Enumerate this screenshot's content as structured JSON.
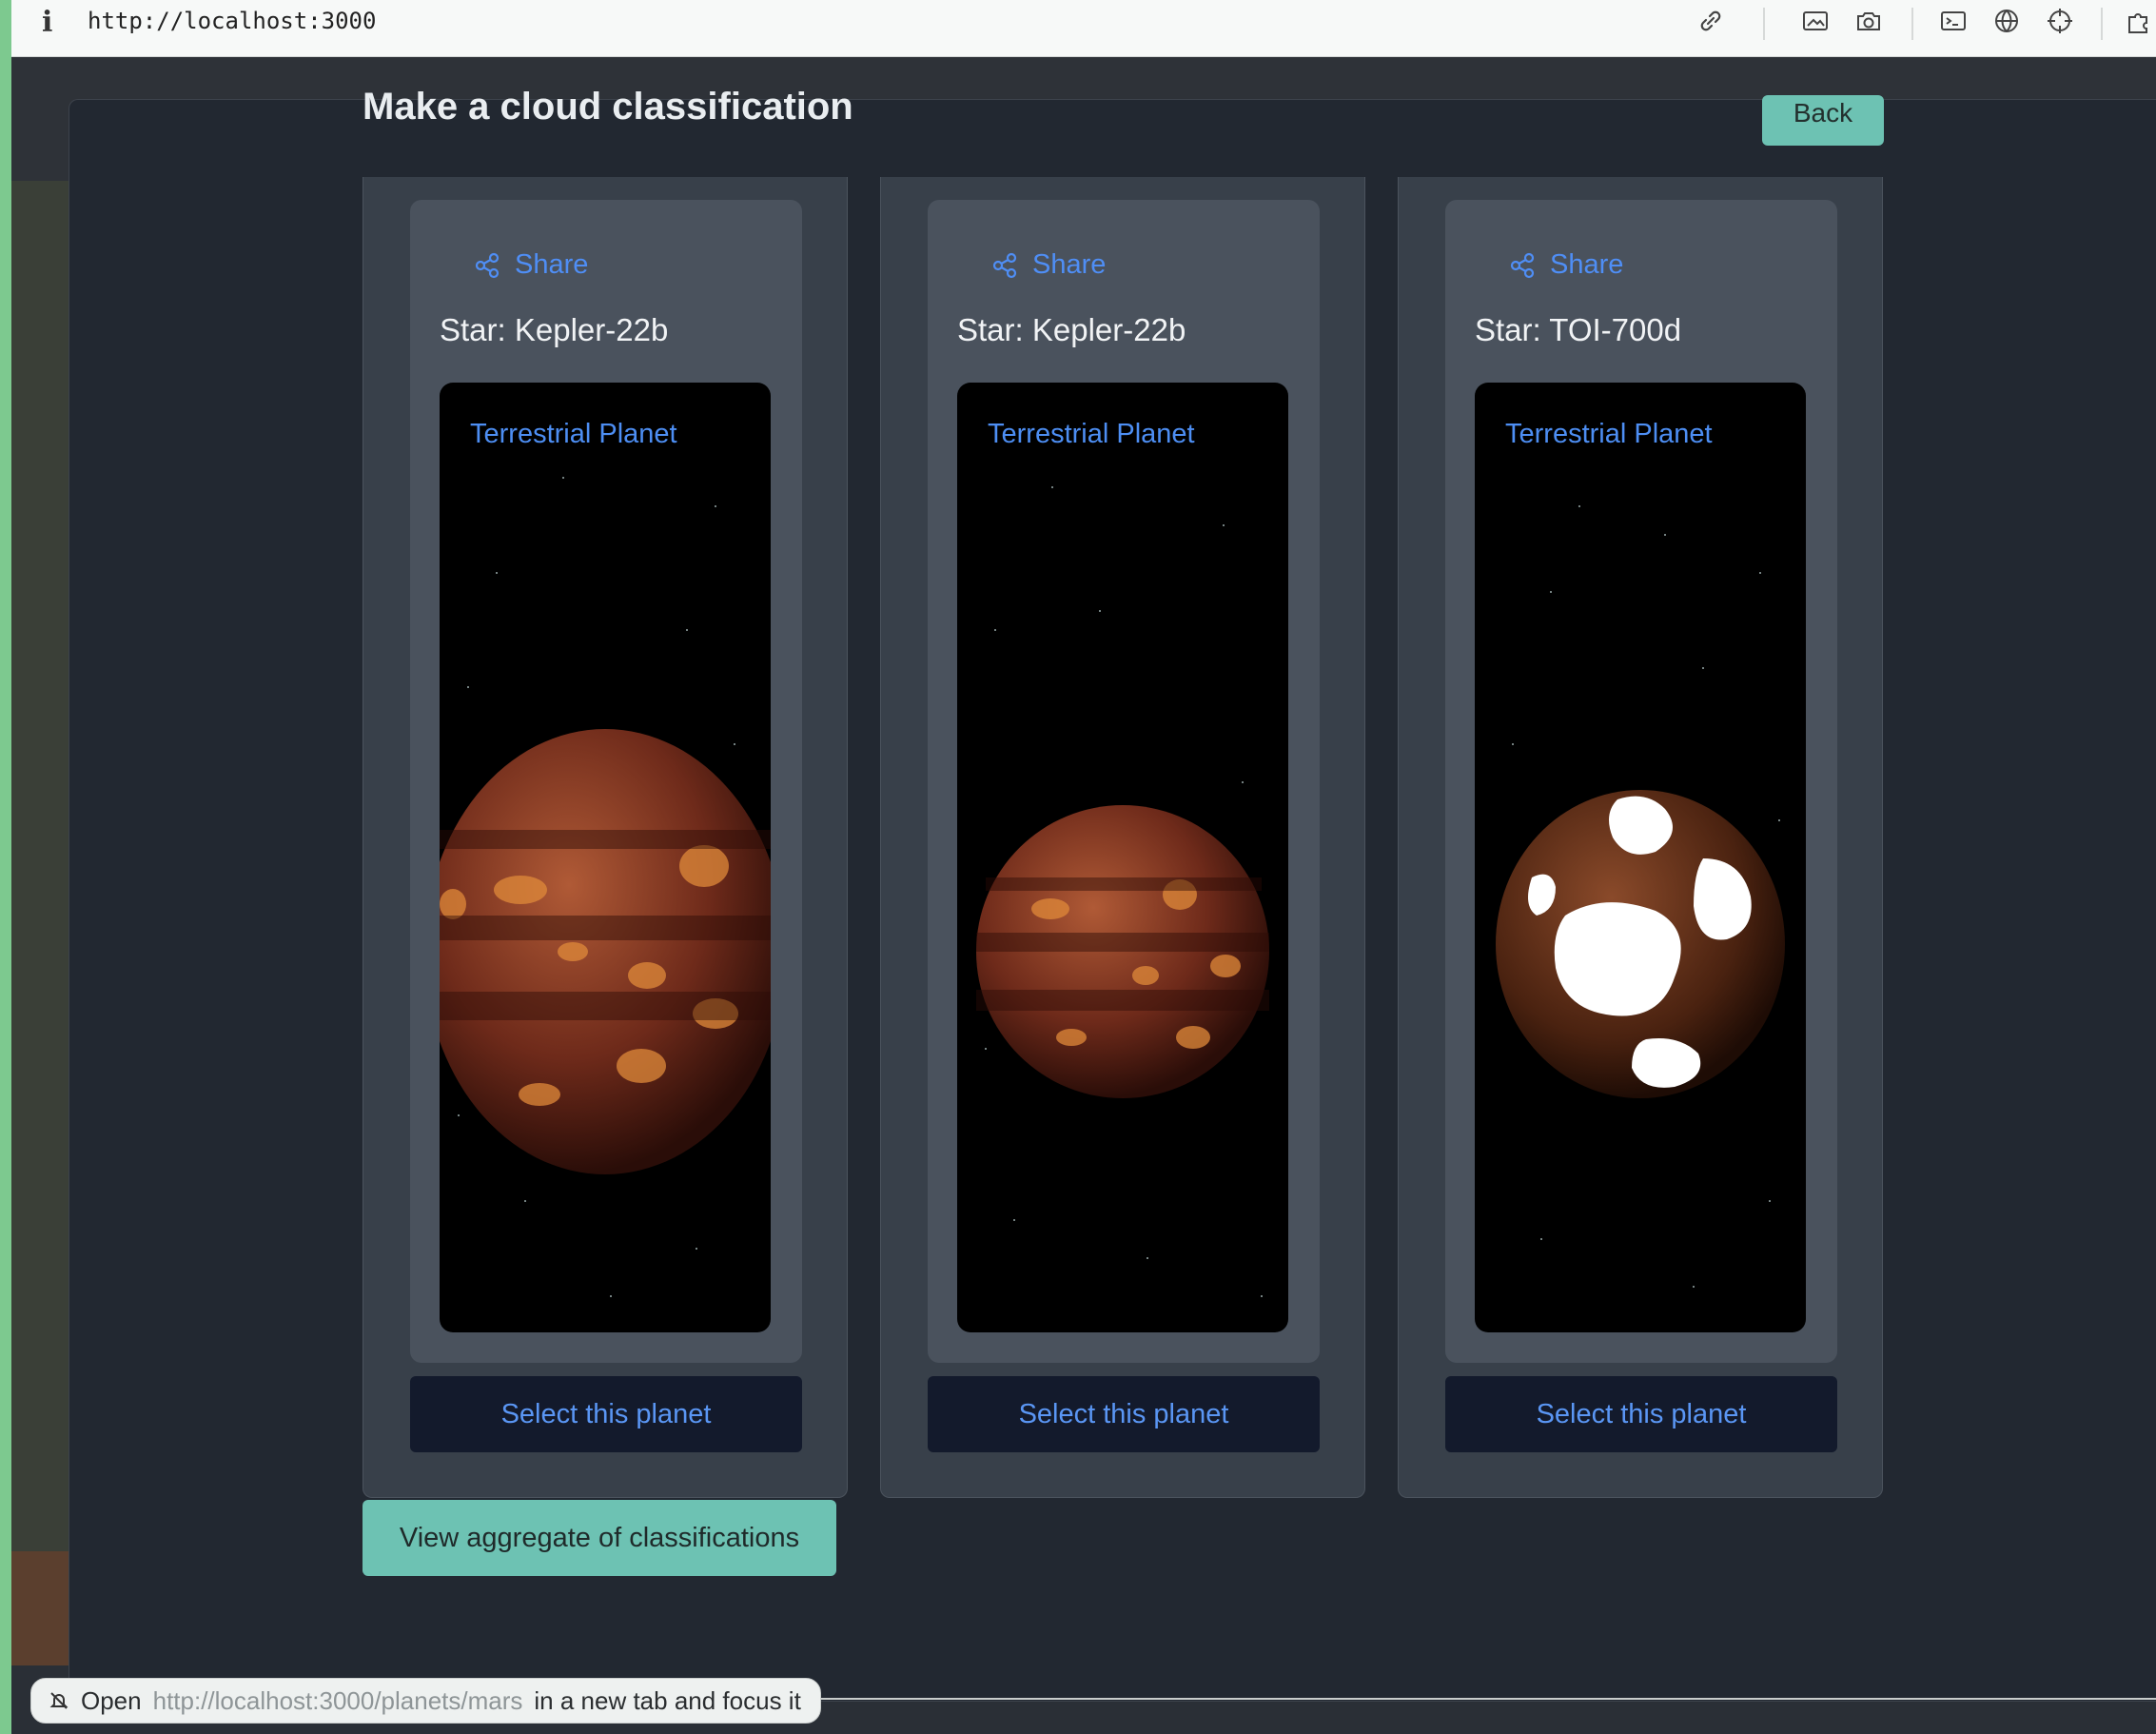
{
  "browser": {
    "url": "http://localhost:3000",
    "info_icon": "i"
  },
  "modal": {
    "title": "Make a cloud classification",
    "back_label": "Back",
    "aggregate_label": "View aggregate of classifications"
  },
  "cards": [
    {
      "share_label": "Share",
      "star": "Star: Kepler-22b",
      "planet_type": "Terrestrial Planet",
      "select_label": "Select this planet"
    },
    {
      "share_label": "Share",
      "star": "Star: Kepler-22b",
      "planet_type": "Terrestrial Planet",
      "select_label": "Select this planet"
    },
    {
      "share_label": "Share",
      "star": "Star: TOI-700d",
      "planet_type": "Terrestrial Planet",
      "select_label": "Select this planet"
    }
  ],
  "status": {
    "prefix": "Open",
    "link": "http://localhost:3000/planets/mars",
    "suffix": "in a new tab and focus it"
  },
  "colors": {
    "accent_teal": "#6dc2b3",
    "link_blue": "#4f8ef5",
    "modal_bg": "#222831"
  }
}
